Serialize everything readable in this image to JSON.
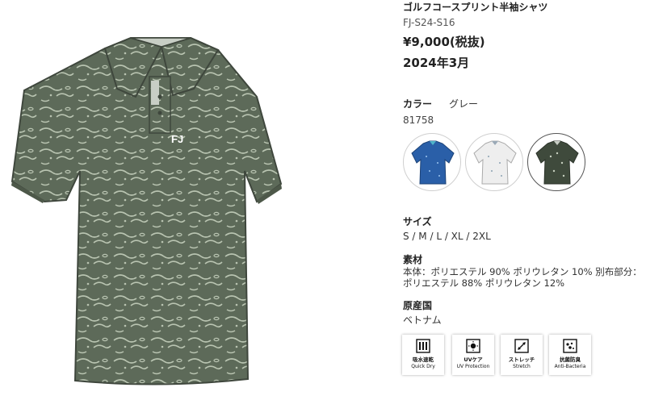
{
  "product": {
    "name": "ゴルフコースプリント半袖シャツ",
    "code": "FJ-S24-S16",
    "price": "¥9,000(税抜)",
    "release": "2024年3月",
    "logo_text": "FJ"
  },
  "color": {
    "label": "カラー",
    "selected_name": "グレー",
    "code": "81758",
    "swatches": [
      {
        "name": "blue",
        "hex": "#2a5fa8"
      },
      {
        "name": "white",
        "hex": "#eeeeee"
      },
      {
        "name": "grey",
        "hex": "#5d6a59"
      }
    ]
  },
  "size": {
    "label": "サイズ",
    "value": "S / M / L / XL / 2XL"
  },
  "material": {
    "label": "素材",
    "line1": "本体：ポリエステル 90% ポリウレタン 10% 別布部分：",
    "line2": "ポリエステル 88% ポリウレタン 12%"
  },
  "origin": {
    "label": "原産国",
    "value": "ベトナム"
  },
  "features": [
    {
      "icon": "quick-dry-icon",
      "jp": "吸水速乾",
      "en": "Quick Dry"
    },
    {
      "icon": "uv-protection-icon",
      "jp": "UVケア",
      "en": "UV Protection"
    },
    {
      "icon": "stretch-icon",
      "jp": "ストレッチ",
      "en": "Stretch"
    },
    {
      "icon": "anti-bacteria-icon",
      "jp": "抗菌防臭",
      "en": "Anti-Bacteria"
    }
  ],
  "colors": {
    "shirt": "#5d6a59",
    "pattern": "#b9c4b1",
    "collar_inner": "#c8cec5"
  }
}
